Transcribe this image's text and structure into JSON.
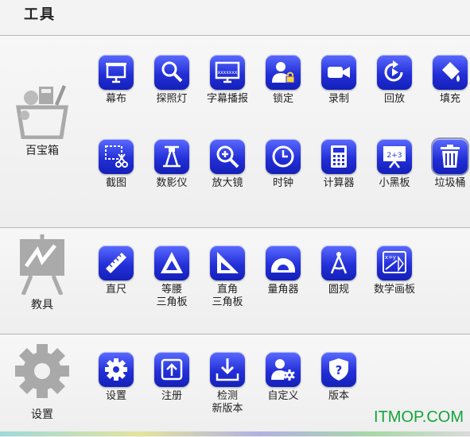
{
  "header": {
    "title": "工具"
  },
  "sections": {
    "tools": {
      "label": "百宝箱",
      "row1": [
        "幕布",
        "探照灯",
        "字幕播报",
        "锁定",
        "录制",
        "回放",
        "填充"
      ],
      "row2": [
        "截图",
        "数影仪",
        "放大镜",
        "时钟",
        "计算器",
        "小黑板",
        "垃圾桶"
      ],
      "screen_text": "xxxxxxx",
      "board_text": "2+3"
    },
    "teaching": {
      "label": "教具",
      "items": [
        "直尺",
        "等腰\n三角板",
        "直角\n三角板",
        "量角器",
        "圆规",
        "数学画板"
      ],
      "math_board_text": "x=y"
    },
    "settings": {
      "label": "设置",
      "items": [
        "设置",
        "注册",
        "检测\n新版本",
        "自定义",
        "版本"
      ]
    }
  },
  "watermark": "ITMOP.COM",
  "colors": {
    "tile_top": "#5a6bff",
    "tile_bottom": "#1320b8",
    "watermark": "#15a43a"
  }
}
